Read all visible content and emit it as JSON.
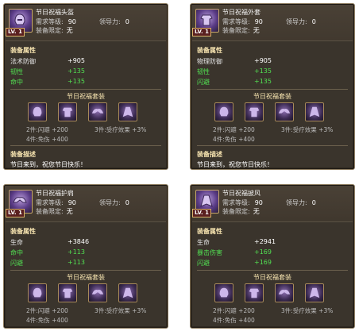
{
  "labels": {
    "req_level": "需求等级:",
    "leadership": "领导力:",
    "limit": "装备限定:",
    "attr_title": "装备属性",
    "set_title": "节日祝福套装",
    "desc_title": "装备描述",
    "bonus_2": "2件:闪避 +200",
    "bonus_3": "3件:受疗效果 +3%",
    "bonus_4": "4件:免伤 +400",
    "desc_text": "节日来到，祝您节日快乐！",
    "lv": "LV. 1"
  },
  "items": [
    {
      "name": "节日祝福头盔",
      "req_level": "90",
      "leadership": "0",
      "limit": "无",
      "attrs": [
        {
          "k": "法术防御",
          "v": "+905",
          "green": false
        },
        {
          "k": "韧性",
          "v": "+135",
          "green": true
        },
        {
          "k": "命中",
          "v": "+135",
          "green": true
        }
      ]
    },
    {
      "name": "节日祝福外套",
      "req_level": "90",
      "leadership": "0",
      "limit": "无",
      "attrs": [
        {
          "k": "物理防御",
          "v": "+905",
          "green": false
        },
        {
          "k": "韧性",
          "v": "+135",
          "green": true
        },
        {
          "k": "闪避",
          "v": "+135",
          "green": true
        }
      ]
    },
    {
      "name": "节日祝福护肩",
      "req_level": "90",
      "leadership": "0",
      "limit": "无",
      "attrs": [
        {
          "k": "生命",
          "v": "+3846",
          "green": false
        },
        {
          "k": "命中",
          "v": "+113",
          "green": true
        },
        {
          "k": "闪避",
          "v": "+113",
          "green": true
        }
      ]
    },
    {
      "name": "节日祝福披风",
      "req_level": "90",
      "leadership": "0",
      "limit": "无",
      "attrs": [
        {
          "k": "生命",
          "v": "+2941",
          "green": false
        },
        {
          "k": "暴击伤害",
          "v": "+169",
          "green": true
        },
        {
          "k": "闪避",
          "v": "+169",
          "green": true
        }
      ]
    }
  ],
  "colors": {
    "panel_bg": "#3a3229",
    "border": "#8b7a5e",
    "accent_gold": "#f7e4b0",
    "stat_green": "#52e052"
  },
  "icons": [
    "helmet-icon",
    "armor-icon",
    "shoulder-icon",
    "cape-icon"
  ]
}
